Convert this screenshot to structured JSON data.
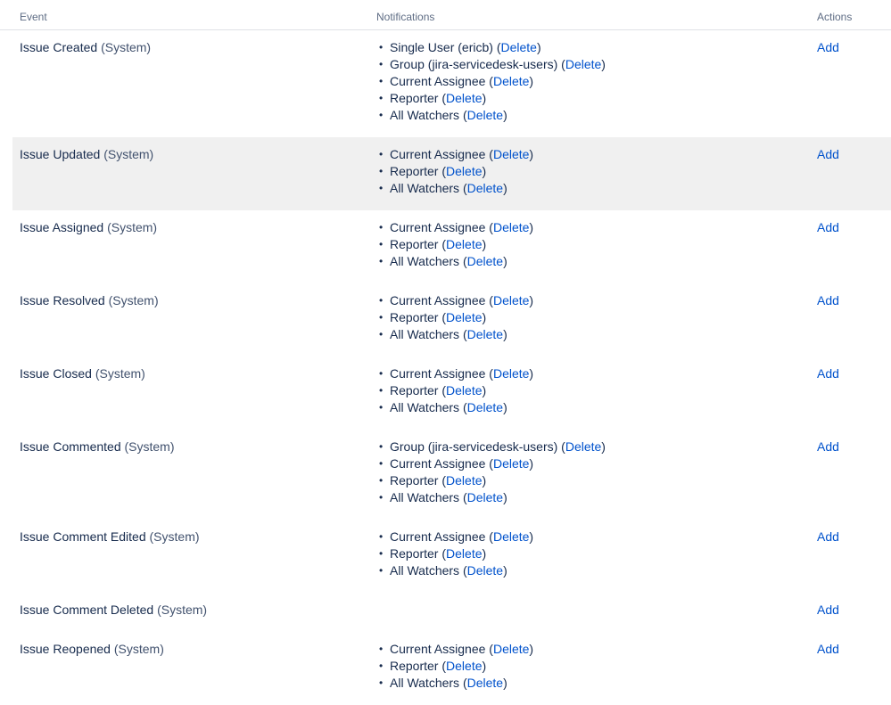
{
  "columns": {
    "event": "Event",
    "notifications": "Notifications",
    "actions": "Actions"
  },
  "delete_label": "Delete",
  "add_label": "Add",
  "rows": [
    {
      "event": "Issue Created",
      "type": "(System)",
      "notifications": [
        {
          "label": "Single User (ericb) (",
          "close": ")"
        },
        {
          "label": "Group (jira-servicedesk-users) (",
          "close": ")"
        },
        {
          "label": "Current Assignee (",
          "close": ")"
        },
        {
          "label": "Reporter (",
          "close": ")"
        },
        {
          "label": "All Watchers (",
          "close": ")"
        }
      ]
    },
    {
      "event": "Issue Updated",
      "type": "(System)",
      "notifications": [
        {
          "label": "Current Assignee (",
          "close": ")"
        },
        {
          "label": "Reporter (",
          "close": ")"
        },
        {
          "label": "All Watchers (",
          "close": ")"
        }
      ]
    },
    {
      "event": "Issue Assigned",
      "type": "(System)",
      "notifications": [
        {
          "label": "Current Assignee (",
          "close": ")"
        },
        {
          "label": "Reporter (",
          "close": ")"
        },
        {
          "label": "All Watchers (",
          "close": ")"
        }
      ]
    },
    {
      "event": "Issue Resolved",
      "type": "(System)",
      "notifications": [
        {
          "label": "Current Assignee (",
          "close": ")"
        },
        {
          "label": "Reporter (",
          "close": ")"
        },
        {
          "label": "All Watchers (",
          "close": ")"
        }
      ]
    },
    {
      "event": "Issue Closed",
      "type": "(System)",
      "notifications": [
        {
          "label": "Current Assignee (",
          "close": ")"
        },
        {
          "label": "Reporter (",
          "close": ")"
        },
        {
          "label": "All Watchers (",
          "close": ")"
        }
      ]
    },
    {
      "event": "Issue Commented",
      "type": "(System)",
      "notifications": [
        {
          "label": "Group (jira-servicedesk-users) (",
          "close": ")"
        },
        {
          "label": "Current Assignee (",
          "close": ")"
        },
        {
          "label": "Reporter (",
          "close": ")"
        },
        {
          "label": "All Watchers (",
          "close": ")"
        }
      ]
    },
    {
      "event": "Issue Comment Edited",
      "type": "(System)",
      "notifications": [
        {
          "label": "Current Assignee (",
          "close": ")"
        },
        {
          "label": "Reporter (",
          "close": ")"
        },
        {
          "label": "All Watchers (",
          "close": ")"
        }
      ]
    },
    {
      "event": "Issue Comment Deleted",
      "type": "(System)",
      "notifications": []
    },
    {
      "event": "Issue Reopened",
      "type": "(System)",
      "notifications": [
        {
          "label": "Current Assignee (",
          "close": ")"
        },
        {
          "label": "Reporter (",
          "close": ")"
        },
        {
          "label": "All Watchers (",
          "close": ")"
        }
      ]
    }
  ],
  "colors": {
    "link": "#0052cc",
    "header_text": "#5e6c84",
    "highlight_row": "#f0f0f0"
  }
}
